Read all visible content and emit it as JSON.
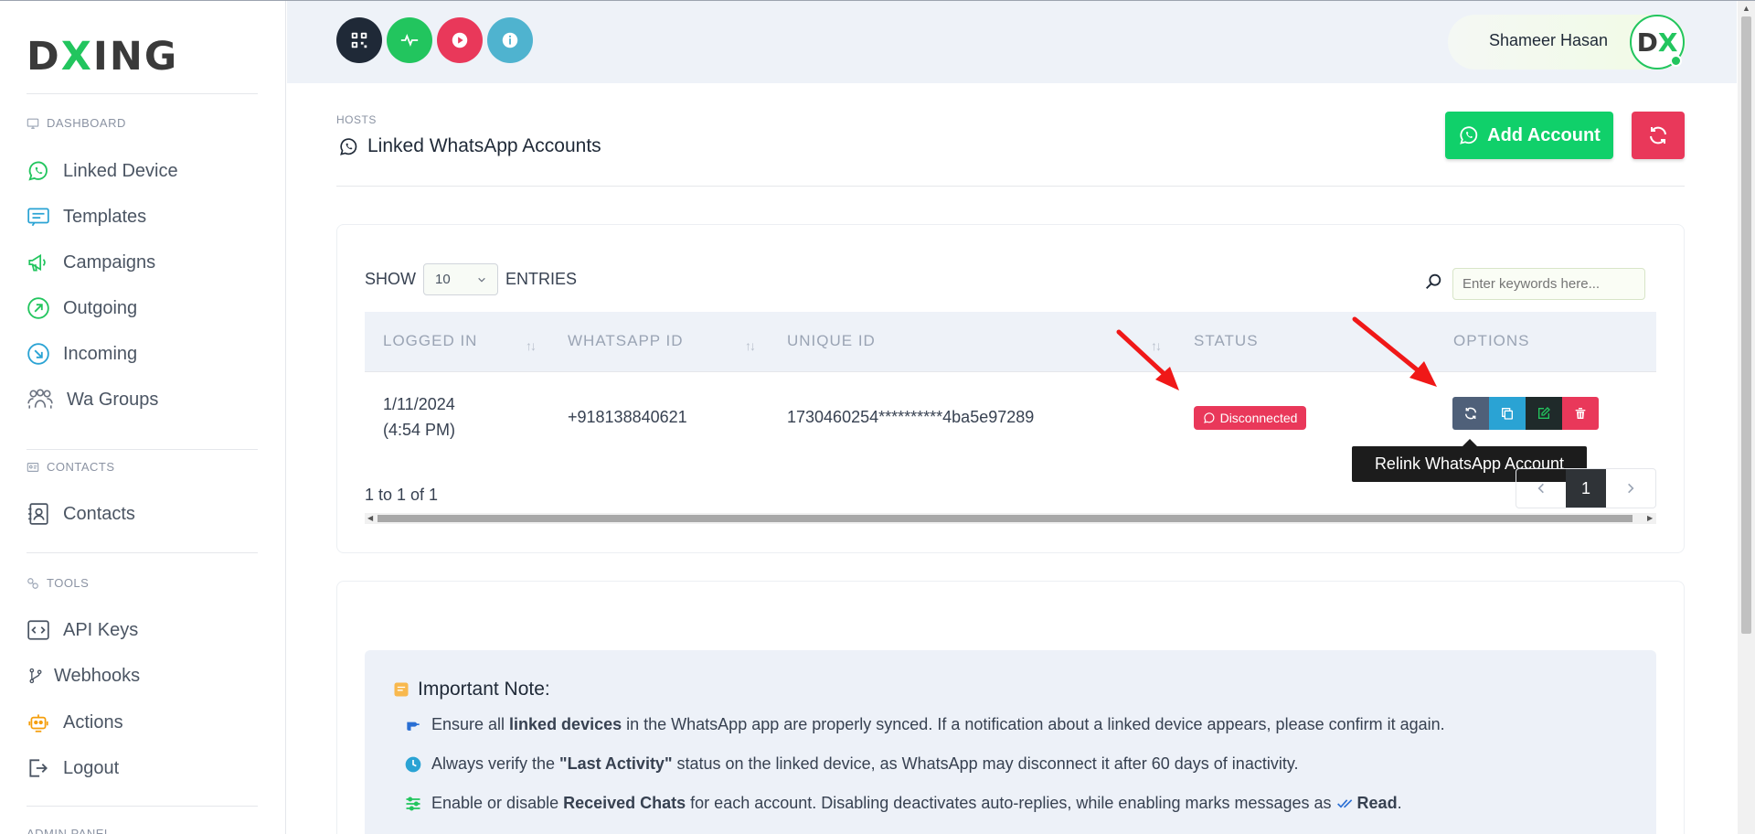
{
  "brand": {
    "logo_left": "D",
    "logo_x": "X",
    "logo_right": "ING"
  },
  "sidebar": {
    "section_dashboard": "DASHBOARD",
    "section_contacts": "CONTACTS",
    "section_tools": "TOOLS",
    "section_admin": "ADMIN PANEL",
    "items": [
      {
        "label": "Linked Device",
        "icon": "whatsapp-icon"
      },
      {
        "label": "Templates",
        "icon": "templates-icon"
      },
      {
        "label": "Campaigns",
        "icon": "megaphone-icon"
      },
      {
        "label": "Outgoing",
        "icon": "arrow-up-right-icon"
      },
      {
        "label": "Incoming",
        "icon": "arrow-down-right-icon"
      },
      {
        "label": "Wa Groups",
        "icon": "group-icon"
      },
      {
        "label": "Contacts",
        "icon": "contact-book-icon"
      },
      {
        "label": "API Keys",
        "icon": "code-icon"
      },
      {
        "label": "Webhooks",
        "icon": "branch-icon"
      },
      {
        "label": "Actions",
        "icon": "robot-icon"
      },
      {
        "label": "Logout",
        "icon": "logout-icon"
      }
    ]
  },
  "header": {
    "buttons": [
      {
        "name": "qr-icon",
        "color": "#1f2937"
      },
      {
        "name": "pulse-icon",
        "color": "#22c55e"
      },
      {
        "name": "play-icon",
        "color": "#e9385a"
      },
      {
        "name": "info-icon",
        "color": "#4fb3cf"
      }
    ],
    "user_name": "Shameer Hasan",
    "avatar_left": "D",
    "avatar_x": "X"
  },
  "page": {
    "breadcrumb": "HOSTS",
    "title": "Linked WhatsApp Accounts",
    "add_button": "Add Account"
  },
  "table": {
    "show_label": "SHOW",
    "page_size": "10",
    "entries_label": "ENTRIES",
    "search_placeholder": "Enter keywords here...",
    "columns": [
      "LOGGED IN",
      "WHATSAPP ID",
      "UNIQUE ID",
      "STATUS",
      "OPTIONS"
    ],
    "rows": [
      {
        "logged_in_date": "1/11/2024",
        "logged_in_time": "(4:54 PM)",
        "whatsapp_id": "+918138840621",
        "unique_id": "1730460254**********4ba5e97289",
        "status": "Disconnected"
      }
    ],
    "tooltip": "Relink WhatsApp Account",
    "info": "1 to 1 of 1",
    "current_page": "1"
  },
  "note": {
    "title": "Important Note:",
    "line1_a": "Ensure all ",
    "line1_b": "linked devices",
    "line1_c": " in the WhatsApp app are properly synced. If a notification about a linked device appears, please confirm it again.",
    "line2_a": "Always verify the ",
    "line2_b": "\"Last Activity\"",
    "line2_c": " status on the linked device, as WhatsApp may disconnect it after 60 days of inactivity.",
    "line3_a": "Enable or disable ",
    "line3_b": "Received Chats",
    "line3_c": " for each account. Disabling deactivates auto-replies, while enabling marks messages as ",
    "line3_d": "Read",
    "line3_e": "."
  },
  "colors": {
    "accent_green": "#10d06a",
    "danger_red": "#e9385a",
    "relink_button": "#4f6079",
    "copy_button": "#2aa3d4",
    "edit_button": "#1f2a2a",
    "delete_button": "#e9385a"
  }
}
